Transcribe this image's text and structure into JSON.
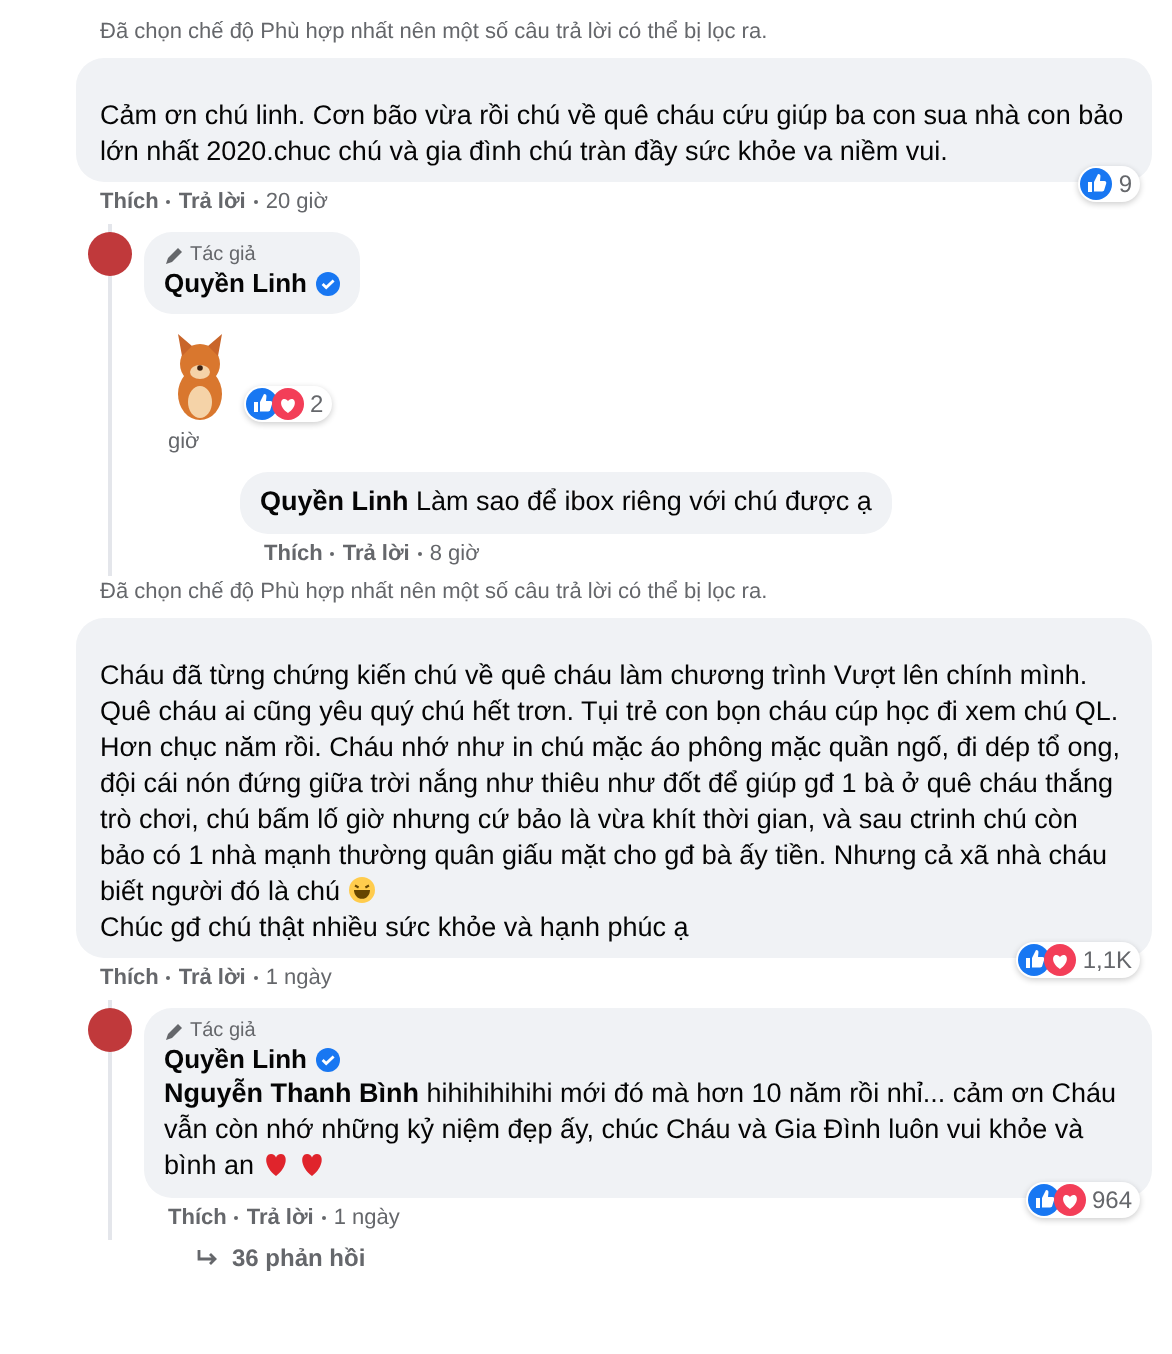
{
  "threads": [
    {
      "notice": "Đã chọn chế độ Phù hợp nhất nên một số câu trả lời có thể bị lọc ra.",
      "comment": {
        "paragraphs": [
          {
            "text": "Cảm ơn chú linh. Cơn bão vừa rồi chú về quê cháu cứu giúp ba con sua nhà con bảo lớn nhất 2020.chuc chú và gia đình chú tràn đầy sức khỏe va niềm vui."
          }
        ],
        "actions": [
          "Thích",
          "Trả lời"
        ],
        "time": "20 giờ",
        "reactions": [
          {
            "kind": "like"
          }
        ],
        "reaction_count": "9"
      },
      "replies": [
        {
          "kind": "sticker",
          "author": "Quyền Linh",
          "badge": "Tác giả",
          "verified": true,
          "reactions": [
            {
              "kind": "like"
            },
            {
              "kind": "love"
            }
          ],
          "reaction_count": "2",
          "time": "giờ"
        },
        {
          "kind": "text",
          "paragraphs": [
            {
              "text": "**Quyền Linh** Làm sao để ibox riêng với chú được ạ"
            }
          ],
          "actions": [
            "Thích",
            "Trả lời"
          ],
          "time": "8 giờ"
        }
      ]
    },
    {
      "notice": "Đã chọn chế độ Phù hợp nhất nên một số câu trả lời có thể bị lọc ra.",
      "comment": {
        "paragraphs": [
          {
            "text": "Cháu đã từng chứng kiến chú về quê cháu làm chương trình Vượt lên chính mình. Quê cháu ai cũng yêu quý chú hết trơn. Tụi trẻ con bọn cháu cúp học đi xem chú QL. Hơn chục năm rồi. Cháu nhớ như in chú mặc áo phông mặc quần ngố, đi dép tổ ong, đội cái nón đứng giữa trời nắng như thiêu như đốt để giúp gđ 1 bà ở quê cháu thắng trò chơi, chú bấm lố giờ nhưng cứ bảo là vừa khít thời gian, và sau ctrinh chú còn bảo có 1 nhà mạnh thường quân giấu mặt cho gđ bà ấy tiền. Nhưng cả xã nhà cháu biết người đó là chú",
            "emoji": [
              {
                "kind": "laugh"
              }
            ]
          },
          {
            "text": "Chúc gđ chú thật nhiều sức khỏe và hạnh phúc ạ"
          }
        ],
        "actions": [
          "Thích",
          "Trả lời"
        ],
        "time": "1 ngày",
        "reactions": [
          {
            "kind": "like"
          },
          {
            "kind": "love"
          }
        ],
        "reaction_count": "1,1K"
      },
      "replies": [
        {
          "kind": "text",
          "author": "Quyền Linh",
          "badge": "Tác giả",
          "verified": true,
          "paragraphs": [
            {
              "text": "**Nguyễn Thanh Bình** hihihihihihi mới đó mà hơn 10 năm rồi nhỉ... cảm ơn Cháu vẫn còn nhớ những kỷ niệm đẹp ấy, chúc Cháu và Gia Đình luôn vui khỏe và bình an",
              "emoji": [
                {
                  "kind": "heart"
                },
                {
                  "kind": "heart"
                }
              ]
            }
          ],
          "actions": [
            "Thích",
            "Trả lời"
          ],
          "time": "1 ngày",
          "reactions": [
            {
              "kind": "like"
            },
            {
              "kind": "love"
            }
          ],
          "reaction_count": "964"
        }
      ],
      "more_replies": "36 phản hồi"
    }
  ]
}
